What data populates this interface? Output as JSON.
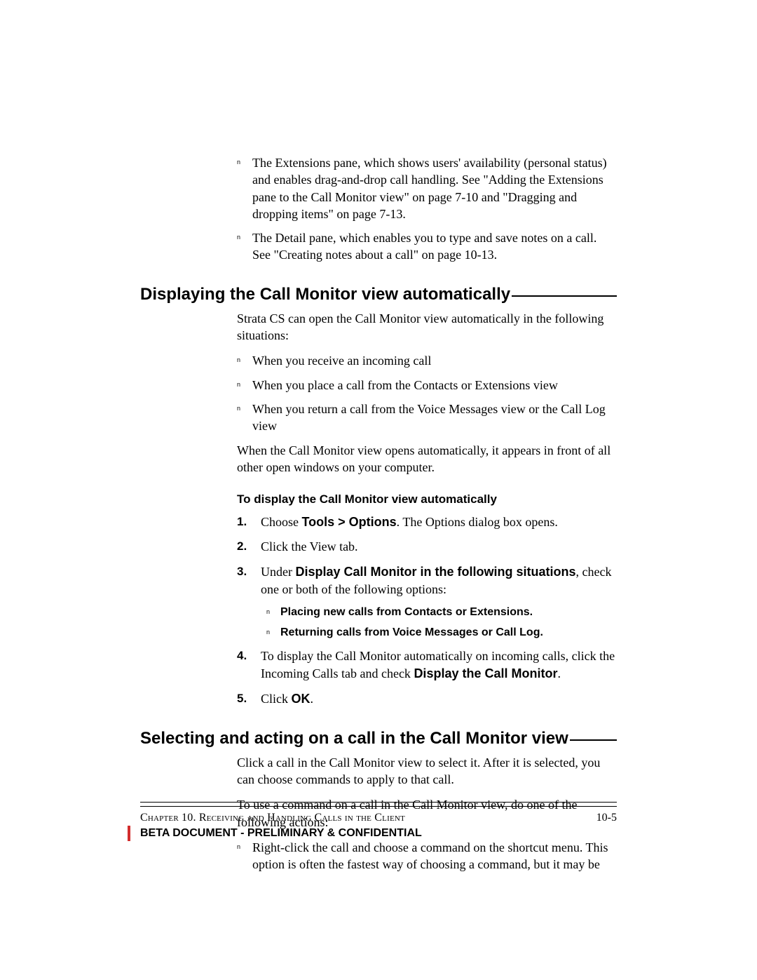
{
  "intro_bullets": [
    "The Extensions pane, which shows users' availability (personal status) and enables drag-and-drop call handling. See \"Adding the Extensions pane to the Call Monitor view\" on page 7-10 and \"Dragging and dropping items\" on page 7-13.",
    "The Detail pane, which enables you to type and save notes on a call. See \"Creating notes about a call\" on page 10-13."
  ],
  "section1": {
    "heading": "Displaying the Call Monitor view automatically",
    "intro": "Strata CS can open the Call Monitor view automatically in the following situations:",
    "bullets": [
      "When you receive an incoming call",
      "When you place a call from the Contacts or Extensions view",
      "When you return a call from the Voice Messages view or the Call Log view"
    ],
    "after_bullets": "When the Call Monitor view opens automatically, it appears in front of all other open windows on your computer.",
    "sub_heading": "To display the Call Monitor view automatically",
    "steps": {
      "s1_pre": "Choose ",
      "s1_bold": "Tools > Options",
      "s1_post": ". The Options dialog box opens.",
      "s2": "Click the View tab.",
      "s3_pre": "Under ",
      "s3_bold": "Display Call Monitor in the following situations",
      "s3_post": ", check one or both of the following options:",
      "s3_opts": [
        "Placing new calls from Contacts or Extensions",
        "Returning calls from Voice Messages or Call Log"
      ],
      "s4_pre": "To display the Call Monitor automatically on incoming calls, click the Incoming Calls tab and check ",
      "s4_bold": "Display the Call Monitor",
      "s4_post": ".",
      "s5_pre": "Click ",
      "s5_bold": "OK",
      "s5_post": "."
    }
  },
  "section2": {
    "heading": "Selecting and acting on a call in the Call Monitor view",
    "p1": "Click a call in the Call Monitor view to select it. After it is selected, you can choose commands to apply to that call.",
    "p2": "To use a command on a call in the Call Monitor view, do one of the following actions:",
    "bullets": [
      "Right-click the call and choose a command on the shortcut menu. This option is often the fastest way of choosing a command, but it may be"
    ]
  },
  "footer": {
    "chapter_label": "Chapter 10. Receiving and Handling Calls in the Client",
    "page_number": "10-5",
    "confidential": "BETA DOCUMENT - PRELIMINARY & CONFIDENTIAL"
  }
}
